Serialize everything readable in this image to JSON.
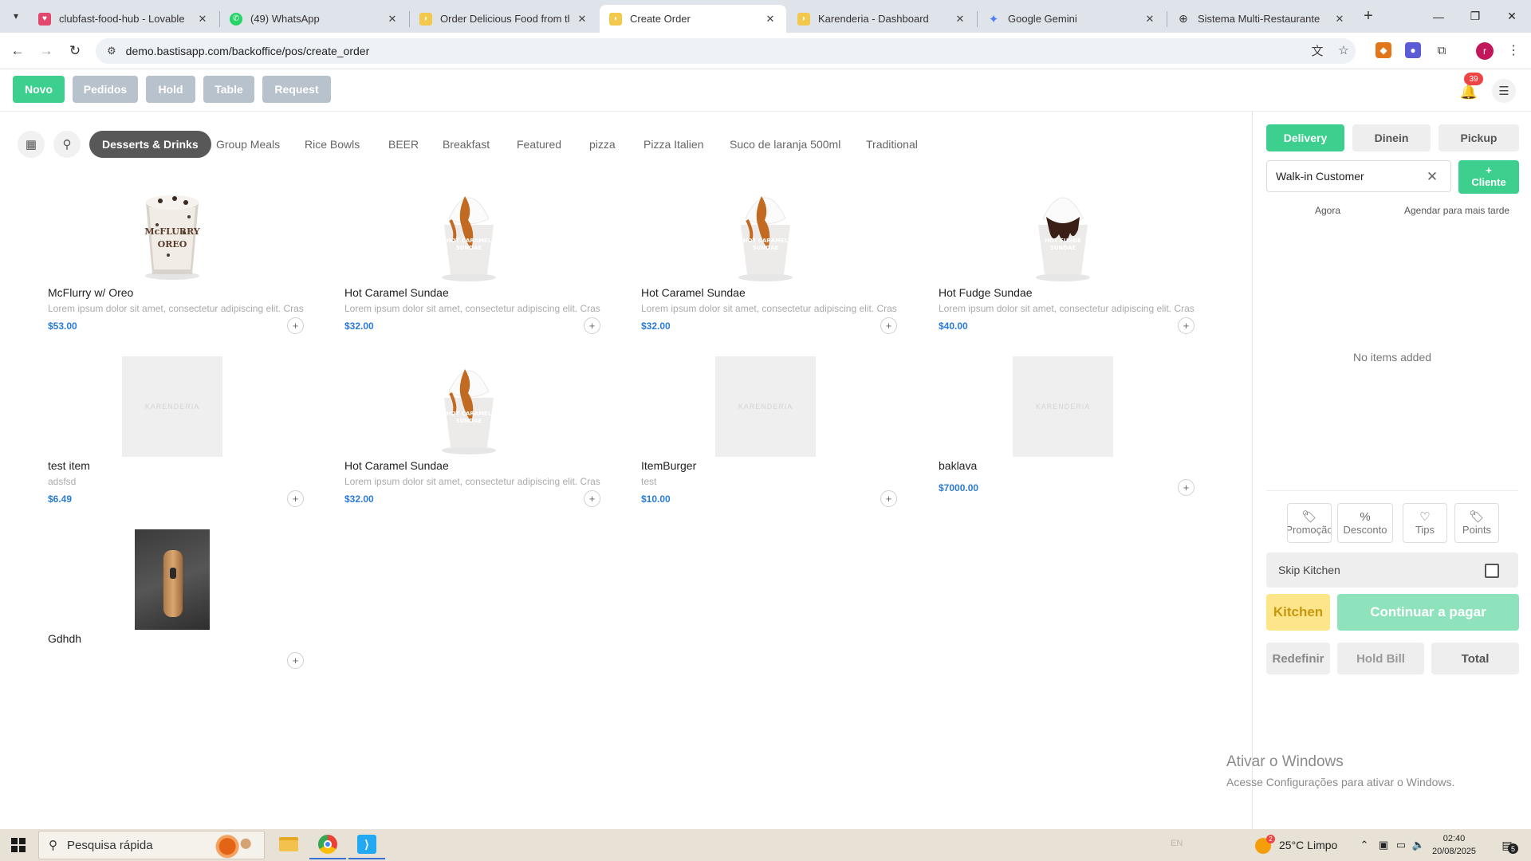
{
  "browser": {
    "tabs": [
      {
        "title": "clubfast-food-hub - Lovable",
        "active": false
      },
      {
        "title": "(49) WhatsApp",
        "active": false
      },
      {
        "title": "Order Delicious Food from the",
        "active": false
      },
      {
        "title": "Create Order",
        "active": true
      },
      {
        "title": "Karenderia - Dashboard",
        "active": false
      },
      {
        "title": "Google Gemini",
        "active": false
      },
      {
        "title": "Sistema Multi-Restaurante",
        "active": false
      }
    ],
    "url": "demo.bastisapp.com/backoffice/pos/create_order"
  },
  "topbar": {
    "buttons": [
      "Novo",
      "Pedidos",
      "Hold",
      "Table",
      "Request"
    ],
    "notification_count": "39"
  },
  "categories": {
    "active": "Desserts & Drinks",
    "items": [
      "Group Meals",
      "Rice Bowls",
      "BEER",
      "Breakfast",
      "Featured",
      "pizza",
      "Pizza Italien",
      "Suco de laranja 500ml",
      "Traditional"
    ]
  },
  "placeholder_watermark": "KARENDERIA",
  "products": [
    {
      "name": "McFlurry w/ Oreo",
      "desc": "Lorem ipsum dolor sit amet, consectetur adipiscing elit. Cras",
      "price": "$53.00",
      "image": "mcflurry"
    },
    {
      "name": "Hot Caramel Sundae",
      "desc": "Lorem ipsum dolor sit amet, consectetur adipiscing elit. Cras",
      "price": "$32.00",
      "image": "caramel-sundae"
    },
    {
      "name": "Hot Caramel Sundae",
      "desc": "Lorem ipsum dolor sit amet, consectetur adipiscing elit. Cras",
      "price": "$32.00",
      "image": "caramel-sundae"
    },
    {
      "name": "Hot Fudge Sundae",
      "desc": "Lorem ipsum dolor sit amet, consectetur adipiscing elit. Cras",
      "price": "$40.00",
      "image": "fudge-sundae"
    },
    {
      "name": "test item",
      "desc": "adsfsd",
      "price": "$6.49",
      "image": "placeholder"
    },
    {
      "name": "Hot Caramel Sundae",
      "desc": "Lorem ipsum dolor sit amet, consectetur adipiscing elit. Cras",
      "price": "$32.00",
      "image": "caramel-sundae"
    },
    {
      "name": "ItemBurger",
      "desc": "test",
      "price": "$10.00",
      "image": "placeholder"
    },
    {
      "name": "baklava",
      "desc": "",
      "price": "$7000.00",
      "image": "placeholder"
    },
    {
      "name": "Gdhdh",
      "desc": "",
      "price": "",
      "image": "photo"
    }
  ],
  "order_panel": {
    "order_types": [
      "Delivery",
      "Dinein",
      "Pickup"
    ],
    "active_order_type": "Delivery",
    "customer_value": "Walk-in Customer",
    "add_customer_label": "Cliente",
    "schedule_now": "Agora",
    "schedule_later": "Agendar para mais tarde",
    "empty_message": "No items added",
    "extras": [
      "Promoção",
      "Desconto",
      "Tips",
      "Points"
    ],
    "skip_kitchen_label": "Skip Kitchen",
    "kitchen_label": "Kitchen",
    "pay_label": "Continuar a pagar",
    "reset_label": "Redefinir",
    "hold_bill_label": "Hold Bill",
    "total_label": "Total"
  },
  "watermark": {
    "line1": "Ativar o Windows",
    "line2": "Acesse Configurações para ativar o Windows."
  },
  "taskbar": {
    "search_placeholder": "Pesquisa rápida",
    "lang": "EN",
    "weather_badge": "2",
    "weather": "25°C  Limpo",
    "time": "02:40",
    "date": "20/08/2025",
    "notifications": "5"
  },
  "colors": {
    "accent_green": "#3ccf8e",
    "button_grey": "#b8c2cc",
    "price_blue": "#2b7bd8",
    "kitchen_yellow": "#fde68a"
  }
}
